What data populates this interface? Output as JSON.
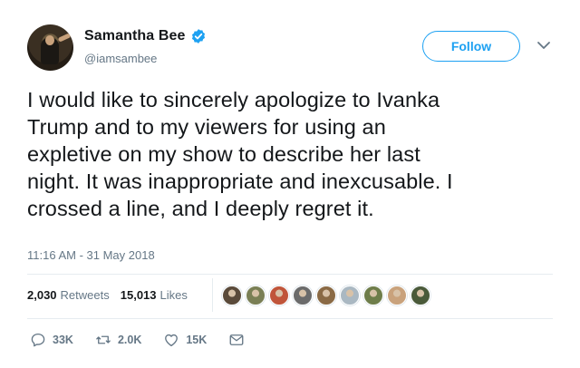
{
  "author": {
    "display_name": "Samantha Bee",
    "handle": "@iamsambee",
    "verified": true
  },
  "follow_button": {
    "label": "Follow"
  },
  "tweet": {
    "lines": [
      "I would like to sincerely apologize to Ivanka",
      "Trump and to my viewers for using an",
      "expletive on my show to describe her last",
      "night. It was inappropriate and inexcusable. I",
      "crossed a line, and I deeply regret it."
    ],
    "timestamp": "11:16 AM - 31 May 2018"
  },
  "stats": {
    "retweets_count": "2,030",
    "retweets_label": "Retweets",
    "likes_count": "15,013",
    "likes_label": "Likes"
  },
  "likers": [
    {
      "color": "#5a4a3a"
    },
    {
      "color": "#7a7f55"
    },
    {
      "color": "#c0553a"
    },
    {
      "color": "#6b6b6b"
    },
    {
      "color": "#8a6a45"
    },
    {
      "color": "#aab8c2"
    },
    {
      "color": "#6e7d4a"
    },
    {
      "color": "#c9a27c"
    },
    {
      "color": "#4a5a3a"
    }
  ],
  "actions": {
    "replies": "33K",
    "retweets": "2.0K",
    "likes": "15K"
  },
  "colors": {
    "accent": "#1da1f2",
    "text": "#14171a",
    "muted": "#657786"
  },
  "icons": [
    "verified-badge-icon",
    "chevron-down-icon",
    "reply-icon",
    "retweet-icon",
    "heart-icon",
    "direct-message-icon"
  ]
}
